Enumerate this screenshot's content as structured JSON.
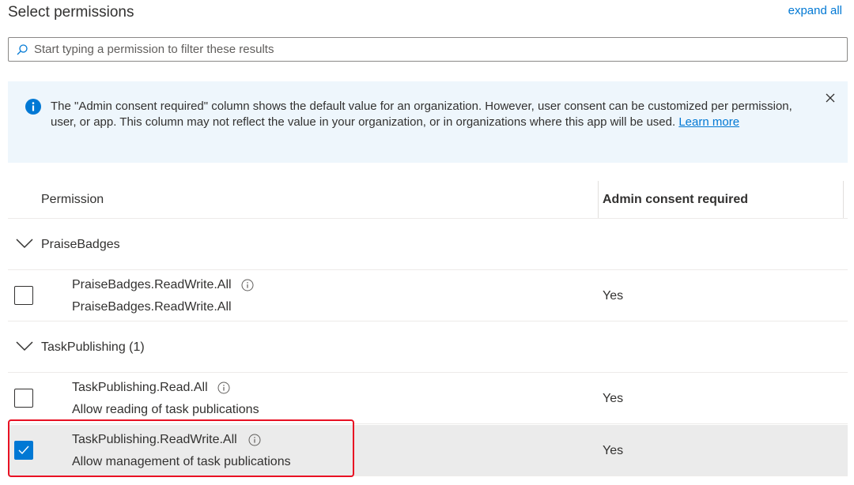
{
  "header": {
    "title": "Select permissions",
    "expand_all_label": "expand all"
  },
  "search": {
    "placeholder": "Start typing a permission to filter these results",
    "value": ""
  },
  "info_banner": {
    "message": "The \"Admin consent required\" column shows the default value for an organization. However, user consent can be customized per permission, user, or app. This column may not reflect the value in your organization, or in organizations where this app will be used.",
    "link_label": "Learn more"
  },
  "table": {
    "columns": [
      "Permission",
      "Admin consent required"
    ],
    "groups": [
      {
        "name": "PraiseBadges",
        "permissions": [
          {
            "name": "PraiseBadges.ReadWrite.All",
            "description": "PraiseBadges.ReadWrite.All",
            "admin_consent": "Yes",
            "checked": false
          }
        ]
      },
      {
        "name": "TaskPublishing (1)",
        "permissions": [
          {
            "name": "TaskPublishing.Read.All",
            "description": "Allow reading of task publications",
            "admin_consent": "Yes",
            "checked": false
          },
          {
            "name": "TaskPublishing.ReadWrite.All",
            "description": "Allow management of task publications",
            "admin_consent": "Yes",
            "checked": true
          }
        ]
      }
    ]
  },
  "icons": {
    "search": "search-icon",
    "info": "info-circle-icon",
    "close": "close-icon",
    "chevron": "chevron-down-icon",
    "permission_info": "info-outline-icon",
    "checkmark": "checkmark-icon"
  },
  "colors": {
    "accent": "#0078d4",
    "banner_background": "#eef6fc",
    "selected_row": "#ebebeb",
    "highlight_border": "#e81123"
  }
}
